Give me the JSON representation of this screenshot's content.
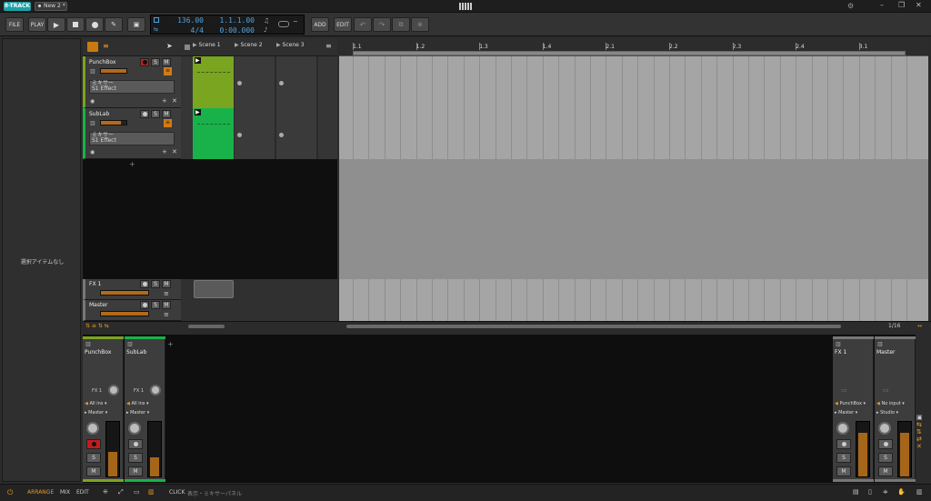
{
  "app": {
    "badge": "8-TRACK",
    "tab": "New 2 *"
  },
  "toolbar": {
    "file": "FILE",
    "play_menu": "PLAY",
    "add": "ADD",
    "edit": "EDIT",
    "tempo": "136.00",
    "signature": "4/4",
    "position": "1.1.1.00",
    "time": "0:00.000"
  },
  "browser": {
    "empty_text": "選択アイテムなし"
  },
  "scenes": [
    "Scene 1",
    "Scene 2",
    "Scene 3"
  ],
  "tracks": [
    {
      "name": "PunchBox",
      "mixer_label": "ミキサー",
      "device": "S1 Effect",
      "color": "#7aa520",
      "armed": true
    },
    {
      "name": "SubLab",
      "mixer_label": "ミキサー",
      "device": "S1 Effect",
      "color": "#19b24a",
      "armed": false
    }
  ],
  "fx_track": {
    "name": "FX 1"
  },
  "master_track": {
    "name": "Master"
  },
  "solo": "S",
  "mute": "M",
  "ruler": [
    "1.1",
    "1.2",
    "1.3",
    "1.4",
    "2.1",
    "2.2",
    "2.3",
    "2.4",
    "3.1"
  ],
  "grid_quant": "1/16",
  "mixer": {
    "strips": [
      {
        "name": "PunchBox",
        "send": "FX 1",
        "input": "All ins",
        "output": "Master",
        "color": "#7aa520",
        "meter": 0.45
      },
      {
        "name": "SubLab",
        "send": "FX 1",
        "input": "All ins",
        "output": "Master",
        "color": "#19b24a",
        "meter": 0.35
      }
    ],
    "fx": {
      "name": "FX 1",
      "input": "PunchBox",
      "output": "Master",
      "meter": 0.8
    },
    "master": {
      "name": "Master",
      "input": "No input",
      "output": "Studio",
      "meter": 0.8
    }
  },
  "footer": {
    "arrange": "ARRANGE",
    "mix": "MIX",
    "edit": "EDIT",
    "hint_key": "CLICK",
    "hint_text": "表示・ミキサーパネル"
  }
}
